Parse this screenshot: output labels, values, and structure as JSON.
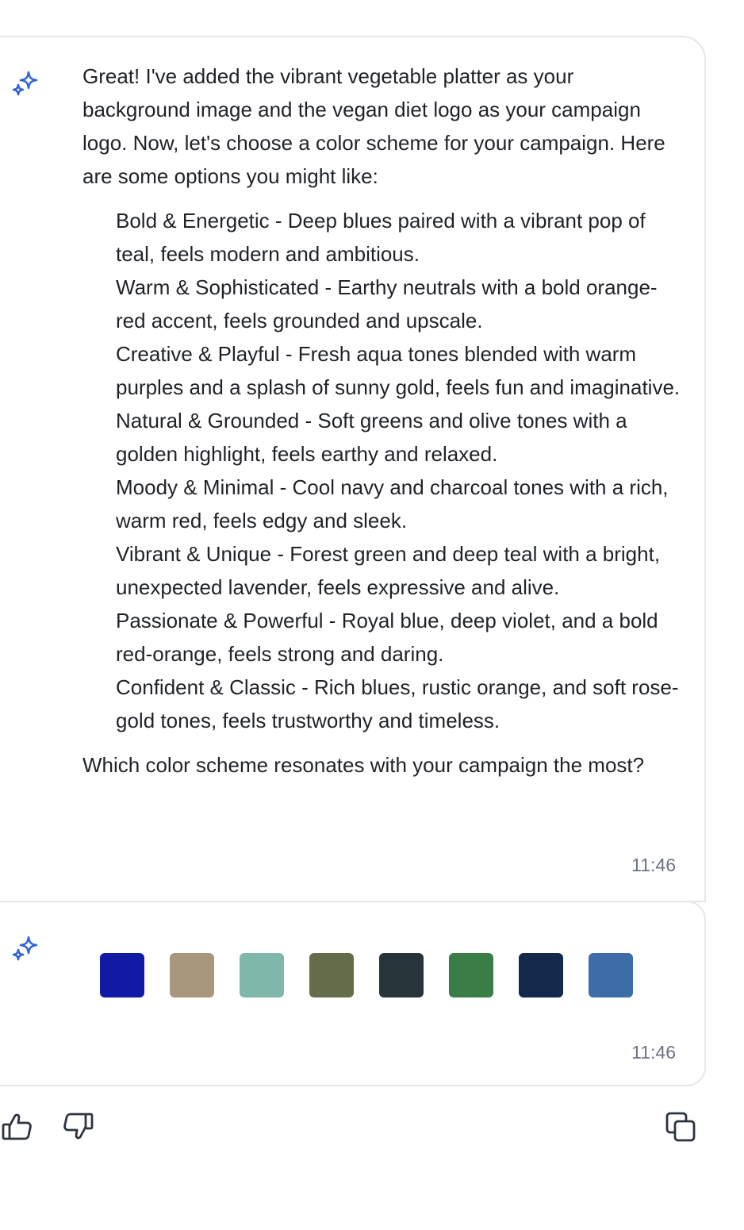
{
  "message": {
    "intro": "Great! I've added the vibrant vegetable platter as your background image and the vegan diet logo as your campaign logo. Now, let's choose a color scheme for your campaign. Here are some options you might like:",
    "options": [
      {
        "text": "Bold & Energetic - Deep blues paired with a vibrant pop of teal, feels modern and ambitious."
      },
      {
        "text": "Warm & Sophisticated - Earthy neutrals with a bold orange-red accent, feels grounded and upscale."
      },
      {
        "text": "Creative & Playful - Fresh aqua tones blended with warm purples and a splash of sunny gold, feels fun and imaginative."
      },
      {
        "text": "Natural & Grounded - Soft greens and olive tones with a golden highlight, feels earthy and relaxed."
      },
      {
        "text": "Moody & Minimal - Cool navy and charcoal tones with a rich, warm red, feels edgy and sleek."
      },
      {
        "text": "Vibrant & Unique - Forest green and deep teal with a bright, unexpected lavender, feels expressive and alive."
      },
      {
        "text": "Passionate & Powerful - Royal blue, deep violet, and a bold red-orange, feels strong and daring."
      },
      {
        "text": "Confident & Classic - Rich blues, rustic orange, and soft rose-gold tones, feels trustworthy and timeless."
      }
    ],
    "question": "Which color scheme resonates with your campaign the most?",
    "time": "11:46"
  },
  "palette": {
    "swatches": [
      "#1119a5",
      "#a8977d",
      "#7fb8aa",
      "#646c4a",
      "#27343a",
      "#3a7d47",
      "#13294b",
      "#3d6ca6"
    ],
    "time": "11:46"
  },
  "colors": {
    "accent": "#2f64d8",
    "border": "#e5e7eb",
    "muted_text": "#6b7280",
    "icon": "#2d3440"
  },
  "icons": {
    "assistant": "sparkle-icon",
    "like": "thumbs-up-icon",
    "dislike": "thumbs-down-icon",
    "copy": "copy-icon"
  }
}
